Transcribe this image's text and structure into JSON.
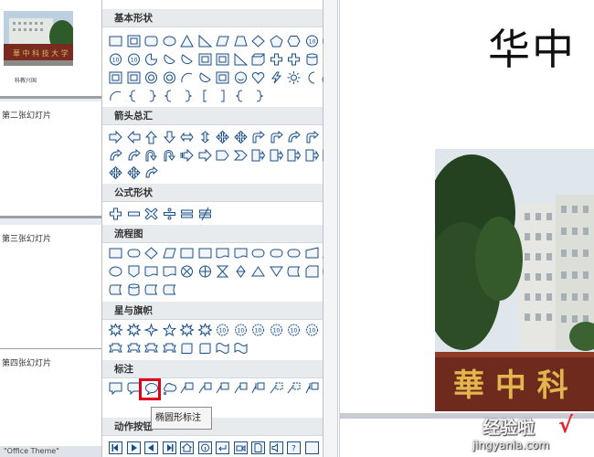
{
  "thumbnails": [
    {
      "label": "",
      "caption": "科教兴国"
    },
    {
      "label": "第二张幻灯片"
    },
    {
      "label": "第三张幻灯片"
    },
    {
      "label": "第四张幻灯片"
    }
  ],
  "status_bar": "\"Office Theme\"",
  "gallery": {
    "sections": [
      {
        "title": "基本形状"
      },
      {
        "title": "箭头总汇"
      },
      {
        "title": "公式形状"
      },
      {
        "title": "流程图"
      },
      {
        "title": "星与旗帜"
      },
      {
        "title": "标注"
      },
      {
        "title": "动作按钮"
      }
    ],
    "tooltip": "椭圆形标注"
  },
  "slide": {
    "title": "华中",
    "sign_text": "華 中 科"
  },
  "watermark": {
    "top": "经验啦",
    "check": "√",
    "bottom": "jingyanla.com"
  },
  "colors": {
    "shape_stroke": "#1c4f86",
    "shape_fill": "#f2f6fb",
    "highlight": "#e0001a",
    "section_header_bg": "#e8ebee"
  }
}
